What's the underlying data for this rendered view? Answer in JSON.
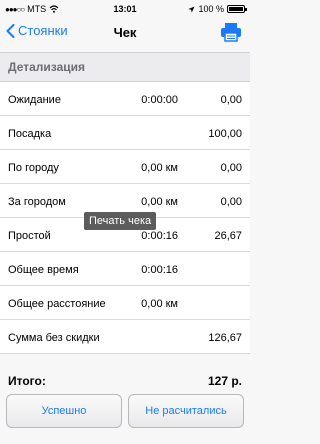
{
  "status_bar": {
    "carrier": "MTS",
    "time": "13:01",
    "battery": "100 %"
  },
  "nav": {
    "back_label": "Стоянки",
    "title": "Чек"
  },
  "section": {
    "title": "Детализация"
  },
  "rows": [
    {
      "label": "Ожидание",
      "value1": "0:00:00",
      "value2": "0,00"
    },
    {
      "label": "Посадка",
      "value1": "",
      "value2": "100,00"
    },
    {
      "label": "По городу",
      "value1": "0,00 км",
      "value2": "0,00"
    },
    {
      "label": "За городом",
      "value1": "0,00 км",
      "value2": "0,00"
    },
    {
      "label": "Простой",
      "value1": "0:00:16",
      "value2": "26,67"
    },
    {
      "label": "Общее время",
      "value1": "0:00:16",
      "value2": ""
    },
    {
      "label": "Общее расстояние",
      "value1": "0,00 км",
      "value2": ""
    },
    {
      "label": "Сумма без скидки",
      "value1": "",
      "value2": "126,67"
    }
  ],
  "tooltip": "Печать чека",
  "total": {
    "label": "Итого:",
    "value": "127 р."
  },
  "buttons": {
    "success": "Успешно",
    "no_pay": "Не расчитались"
  },
  "colors": {
    "accent": "#1a7cf5"
  }
}
